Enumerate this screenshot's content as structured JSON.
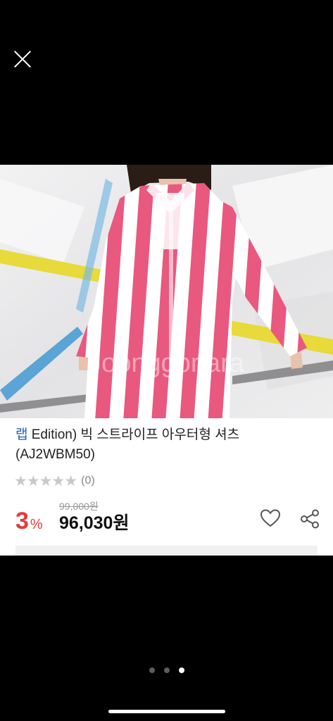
{
  "close": {
    "icon": "close-icon"
  },
  "product": {
    "title_brand": "랩",
    "title_rest": " Edition) 빅 스트라이프 아우터형 셔츠",
    "title_line2": "(AJ2WBM50)",
    "rating_stars": 0,
    "review_count": "(0)",
    "original_price": "99,000원",
    "discount_value": "3",
    "discount_unit": "%",
    "sale_price": "96,030원"
  },
  "actions": {
    "wishlist_icon": "heart-icon",
    "share_icon": "share-icon"
  },
  "pager": {
    "count": 3,
    "active_index": 2
  },
  "colors": {
    "discount": "#e8383b",
    "brand_link": "#1f5fb3",
    "stripe_pink": "#e9587f"
  }
}
